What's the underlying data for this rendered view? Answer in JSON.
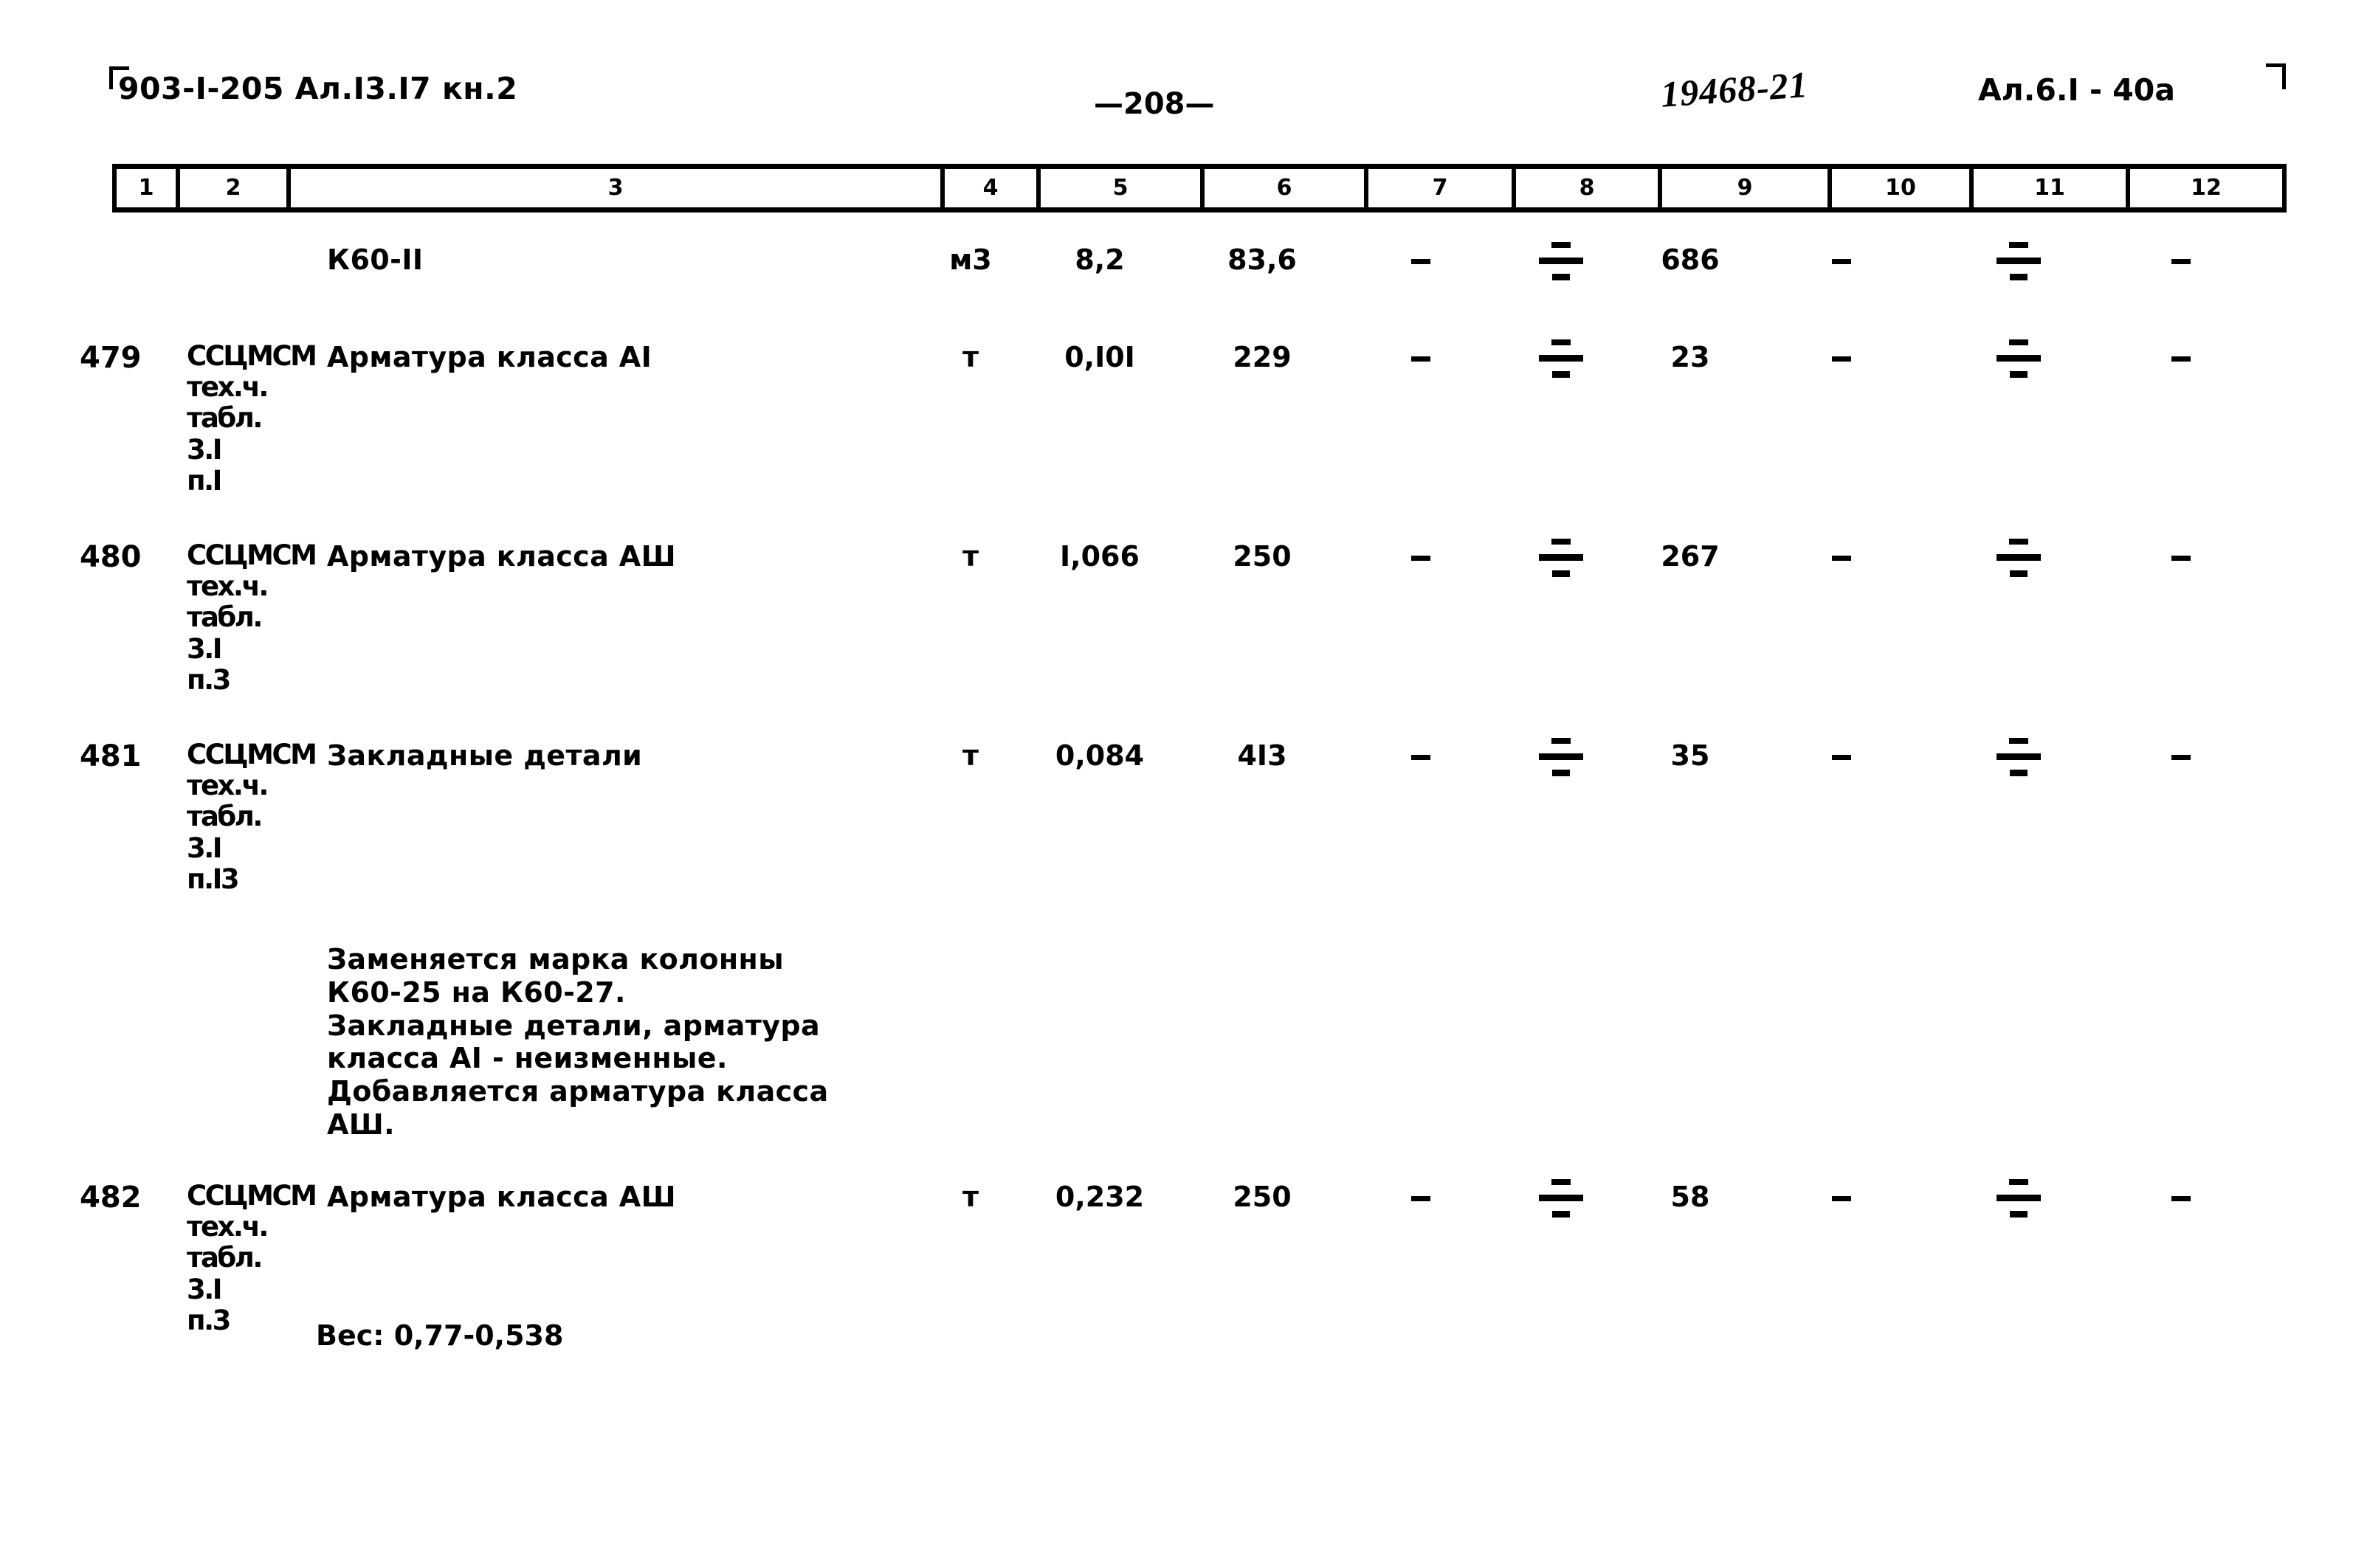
{
  "document": {
    "header": {
      "left_code": "903-I-205 Ал.I3.I7 кн.2",
      "page_number": "—208—",
      "handwritten_stamp": "19468-21",
      "right_code": "Ал.6.I - 40а"
    },
    "column_numbers": [
      "1",
      "2",
      "3",
      "4",
      "5",
      "6",
      "7",
      "8",
      "9",
      "10",
      "11",
      "12"
    ],
    "rows": [
      {
        "num": "",
        "source": "",
        "description": "К60-II",
        "unit": "м3",
        "col5": "8,2",
        "col6": "83,6",
        "col7": "-",
        "col8": "frac",
        "col9": "686",
        "col10": "-",
        "col11": "frac",
        "col12": "-"
      },
      {
        "num": "479",
        "source": "ССЦМСМ\nтех.ч.\nтабл.\n3.I\nп.I",
        "description": "Арматура класса АI",
        "unit": "т",
        "col5": "0,I0I",
        "col6": "229",
        "col7": "-",
        "col8": "frac",
        "col9": "23",
        "col10": "-",
        "col11": "frac",
        "col12": "-"
      },
      {
        "num": "480",
        "source": "ССЦМСМ\nтех.ч.\nтабл.\n3.I\nп.3",
        "description": "Арматура класса АШ",
        "unit": "т",
        "col5": "I,066",
        "col6": "250",
        "col7": "-",
        "col8": "frac",
        "col9": "267",
        "col10": "-",
        "col11": "frac",
        "col12": "-"
      },
      {
        "num": "481",
        "source": "ССЦМСМ\nтех.ч.\nтабл.\n3.I\nп.I3",
        "description": "Закладные детали",
        "unit": "т",
        "col5": "0,084",
        "col6": "4I3",
        "col7": "-",
        "col8": "frac",
        "col9": "35",
        "col10": "-",
        "col11": "frac",
        "col12": "-"
      }
    ],
    "note_block": "Заменяется марка колонны\n К60-25 на К60-27.\nЗакладные детали, арматура\nкласса АI - неизменные.\nДобавляется арматура класса\nАШ.",
    "last_row": {
      "num": "482",
      "source": "ССЦМСМ\nтех.ч.\nтабл.\n3.I\nп.3",
      "description": "Арматура класса АШ",
      "weight_note": "Вес: 0,77-0,538",
      "unit": "т",
      "col5": "0,232",
      "col6": "250",
      "col7": "-",
      "col8": "frac",
      "col9": "58",
      "col10": "-",
      "col11": "frac",
      "col12": "-"
    }
  }
}
